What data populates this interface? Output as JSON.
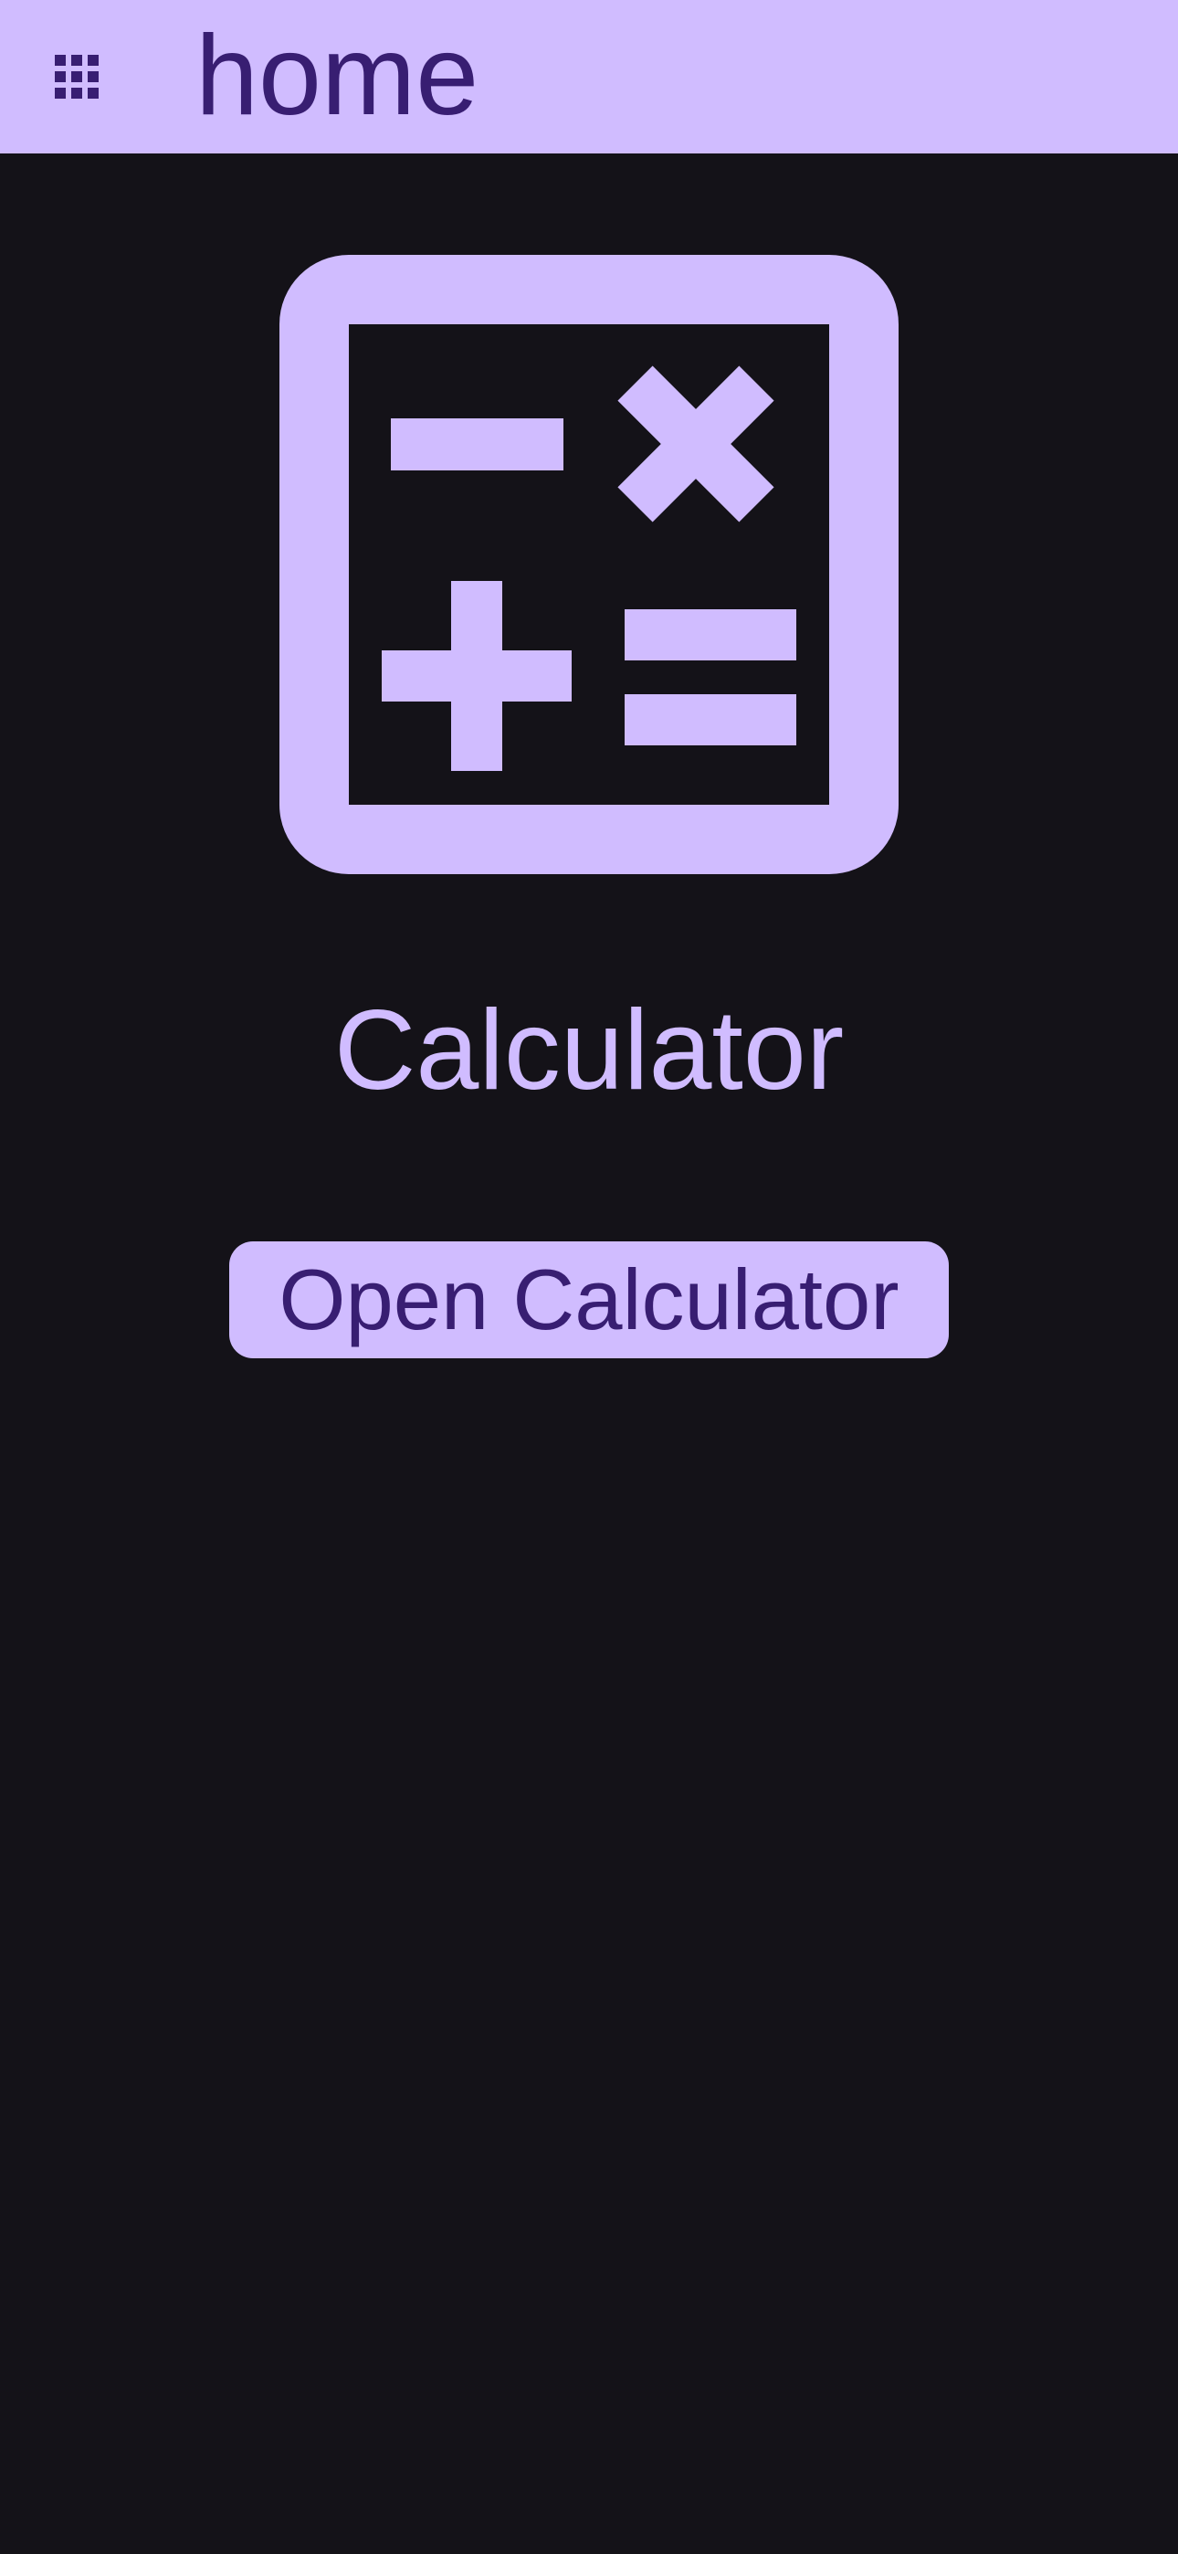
{
  "colors": {
    "background": "#141218",
    "accent": "#d0bcff",
    "on_accent": "#381e72"
  },
  "top_bar": {
    "menu_icon": "apps-grid-icon",
    "title": "home"
  },
  "main": {
    "hero_icon": "calculator-icon",
    "title": "Calculator",
    "open_button_label": "Open Calculator"
  }
}
